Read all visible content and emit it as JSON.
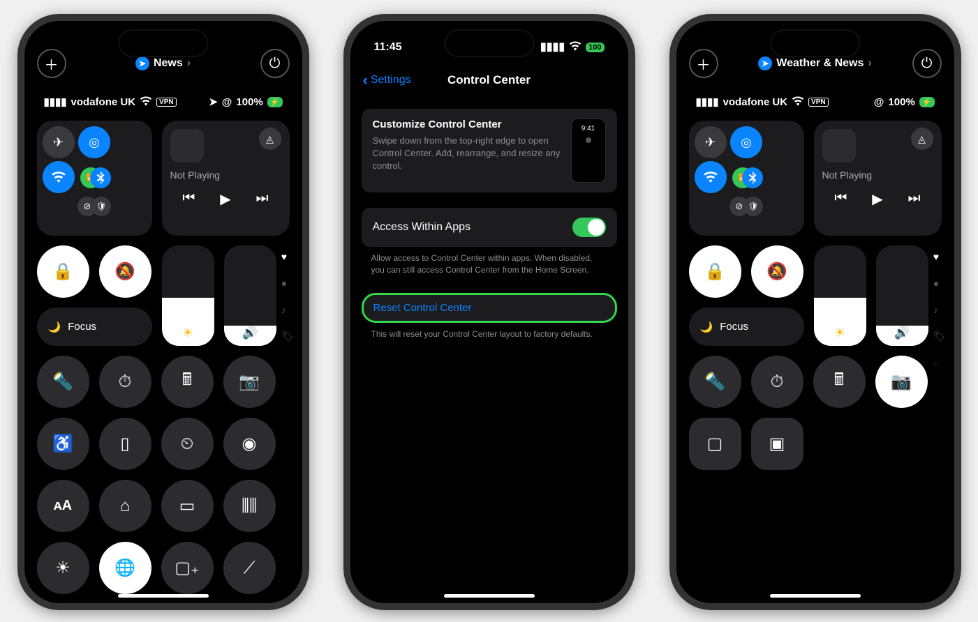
{
  "phoneA": {
    "tab_label": "News",
    "status": {
      "carrier": "vodafone UK",
      "vpn": "VPN",
      "battery": "100%",
      "battery_charging_icon": "⚡"
    },
    "media_not_playing": "Not Playing",
    "focus_label": "Focus",
    "buttons_rowA": [
      "flashlight-icon",
      "timer-icon",
      "calculator-icon",
      "camera-icon"
    ],
    "buttons_rowB": [
      "accessibility-icon",
      "remote-icon",
      "stopwatch-icon",
      "record-icon"
    ],
    "buttons_rowC": [
      "text-size-icon",
      "home-icon",
      "low-power-icon",
      "sound-recognition-icon"
    ],
    "buttons_rowD": [
      "brightness-icon",
      "network-icon",
      "wallet-icon",
      "cell-off-icon"
    ]
  },
  "phoneB": {
    "status_time": "11:45",
    "status_battery": "100",
    "back_label": "Settings",
    "title": "Control Center",
    "card_customize": {
      "heading": "Customize Control Center",
      "body": "Swipe down from the top-right edge to open Control Center. Add, rearrange, and resize any control.",
      "preview_time": "9:41"
    },
    "access_label": "Access Within Apps",
    "access_footer": "Allow access to Control Center within apps. When disabled, you can still access Control Center from the Home Screen.",
    "reset_label": "Reset Control Center",
    "reset_footer": "This will reset your Control Center layout to factory defaults."
  },
  "phoneC": {
    "tab_label": "Weather & News",
    "status": {
      "carrier": "vodafone UK",
      "vpn": "VPN",
      "battery": "100%",
      "battery_charging_icon": "⚡"
    },
    "media_not_playing": "Not Playing",
    "focus_label": "Focus",
    "buttons_rowA": [
      "flashlight-icon",
      "timer-icon",
      "calculator-icon",
      "camera-icon"
    ],
    "buttons_rowB": [
      "screen-mirroring-icon",
      "qr-scanner-icon"
    ]
  },
  "colors": {
    "active_blue": "#0a84ff",
    "active_green": "#34c759",
    "highlight_green": "#32d74b"
  }
}
